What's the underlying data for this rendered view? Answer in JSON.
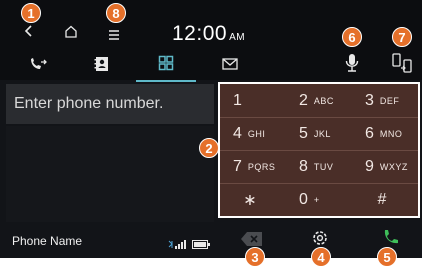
{
  "clock": {
    "time": "12:00",
    "ampm": "AM"
  },
  "nav": {
    "back_icon": "chevron-left-icon",
    "home_icon": "home-icon",
    "menu_icon": "menu-icon"
  },
  "tabs": [
    {
      "name": "call-history",
      "icon": "call-history-icon",
      "active": false
    },
    {
      "name": "contacts",
      "icon": "contacts-icon",
      "active": false
    },
    {
      "name": "keypad",
      "icon": "keypad-icon",
      "active": true
    },
    {
      "name": "messages",
      "icon": "envelope-icon",
      "active": false
    }
  ],
  "top_right": {
    "voice_icon": "microphone-icon",
    "switch_icon": "phone-switch-icon"
  },
  "input": {
    "placeholder": "Enter phone number."
  },
  "keypad": {
    "keys": [
      {
        "num": "1",
        "letters": ""
      },
      {
        "num": "2",
        "letters": "ABC"
      },
      {
        "num": "3",
        "letters": "DEF"
      },
      {
        "num": "4",
        "letters": "GHI"
      },
      {
        "num": "5",
        "letters": "JKL"
      },
      {
        "num": "6",
        "letters": "MNO"
      },
      {
        "num": "7",
        "letters": "PQRS"
      },
      {
        "num": "8",
        "letters": "TUV"
      },
      {
        "num": "9",
        "letters": "WXYZ"
      },
      {
        "num": "∗",
        "letters": ""
      },
      {
        "num": "0",
        "letters": "+"
      },
      {
        "num": "#",
        "letters": ""
      }
    ]
  },
  "status": {
    "phone_name": "Phone Name",
    "signal_icon": "bluetooth-signal-icon",
    "battery_icon": "battery-icon"
  },
  "bottom": {
    "delete_icon": "backspace-icon",
    "settings_icon": "gear-icon",
    "call_icon": "call-icon"
  },
  "callouts": [
    "1",
    "2",
    "3",
    "4",
    "5",
    "6",
    "7",
    "8"
  ],
  "colors": {
    "accent": "#e5702a",
    "tab_active": "#5fb9c9",
    "keypad_bg": "#4a2e28",
    "call_green": "#3fbf5a"
  }
}
